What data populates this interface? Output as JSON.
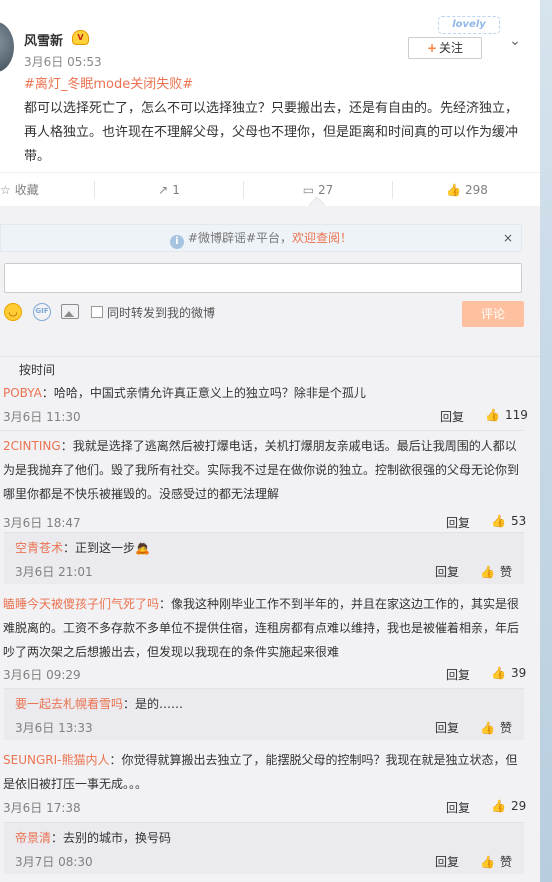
{
  "post": {
    "username": "风雪新",
    "vip_badge": "V",
    "time": "3月6日 05:53",
    "follow_label": "关注",
    "follow_plus": "+",
    "sticker_text": "lovely",
    "topic": "#离灯_冬眠mode关闭失败#",
    "body": "都可以选择死亡了，怎么不可以选择独立？只要搬出去，还是有自由的。先经济独立，再人格独立。也许现在不理解父母，父母也不理你，但是距离和时间真的可以作为缓冲带。"
  },
  "actions": {
    "favorite_label": "收藏",
    "repost_count": "1",
    "comment_count": "27",
    "like_count": "298"
  },
  "notice": {
    "prefix": "#微博辟谣#平台，",
    "highlight": "欢迎查阅！",
    "close": "×"
  },
  "composer": {
    "repost_label": "同时转发到我的微博",
    "submit_label": "评论",
    "gif_label": "GIF"
  },
  "sort_label": "按时间",
  "comments": [
    {
      "user": "POBYA",
      "text": "：哈哈，中国式亲情允许真正意义上的独立吗？除非是个孤儿",
      "time": "3月6日 11:30",
      "reply": "回复",
      "likes": "119"
    },
    {
      "user": "2CINTING",
      "text": "：我就是选择了逃离然后被打爆电话，关机打爆朋友亲戚电话。最后让我周围的人都以为是我抛弃了他们。毁了我所有社交。实际我不过是在做你说的独立。控制欲很强的父母无论你到哪里你都是不快乐被摧毁的。没感受过的都无法理解",
      "time": "3月6日 18:47",
      "reply": "回复",
      "likes": "53",
      "sub": {
        "user": "空青苍术",
        "text": "：正到这一步",
        "time": "3月6日 21:01",
        "reply": "回复",
        "likes": "赞"
      }
    },
    {
      "user": "瞌睡今天被傻孩子们气死了吗",
      "text": "：像我这种刚毕业工作不到半年的，并且在家这边工作的，其实是很难脱离的。工资不多存款不多单位不提供住宿，连租房都有点难以维持，我也是被催着相亲，年后吵了两次架之后想搬出去，但发现以我现在的条件实施起来很难",
      "time": "3月6日 09:29",
      "reply": "回复",
      "likes": "39",
      "sub": {
        "user": "要一起去札幌看雪吗",
        "text": "：是的……",
        "time": "3月6日 13:33",
        "reply": "回复",
        "likes": "赞"
      }
    },
    {
      "user": "SEUNGRI-熊猫内人",
      "text": "：你觉得就算搬出去独立了，能摆脱父母的控制吗？我现在就是独立状态，但是依旧被打压一事无成。。。",
      "time": "3月6日 17:38",
      "reply": "回复",
      "likes": "29",
      "sub": {
        "user": "帝景清",
        "text": "：去别的城市，换号码",
        "time": "3月7日 08:30",
        "reply": "回复",
        "likes": "赞"
      }
    }
  ],
  "colors": {
    "accent": "#eb7350",
    "submit_disabled": "#ffc09f",
    "page_bg": "#f2f2f5"
  }
}
